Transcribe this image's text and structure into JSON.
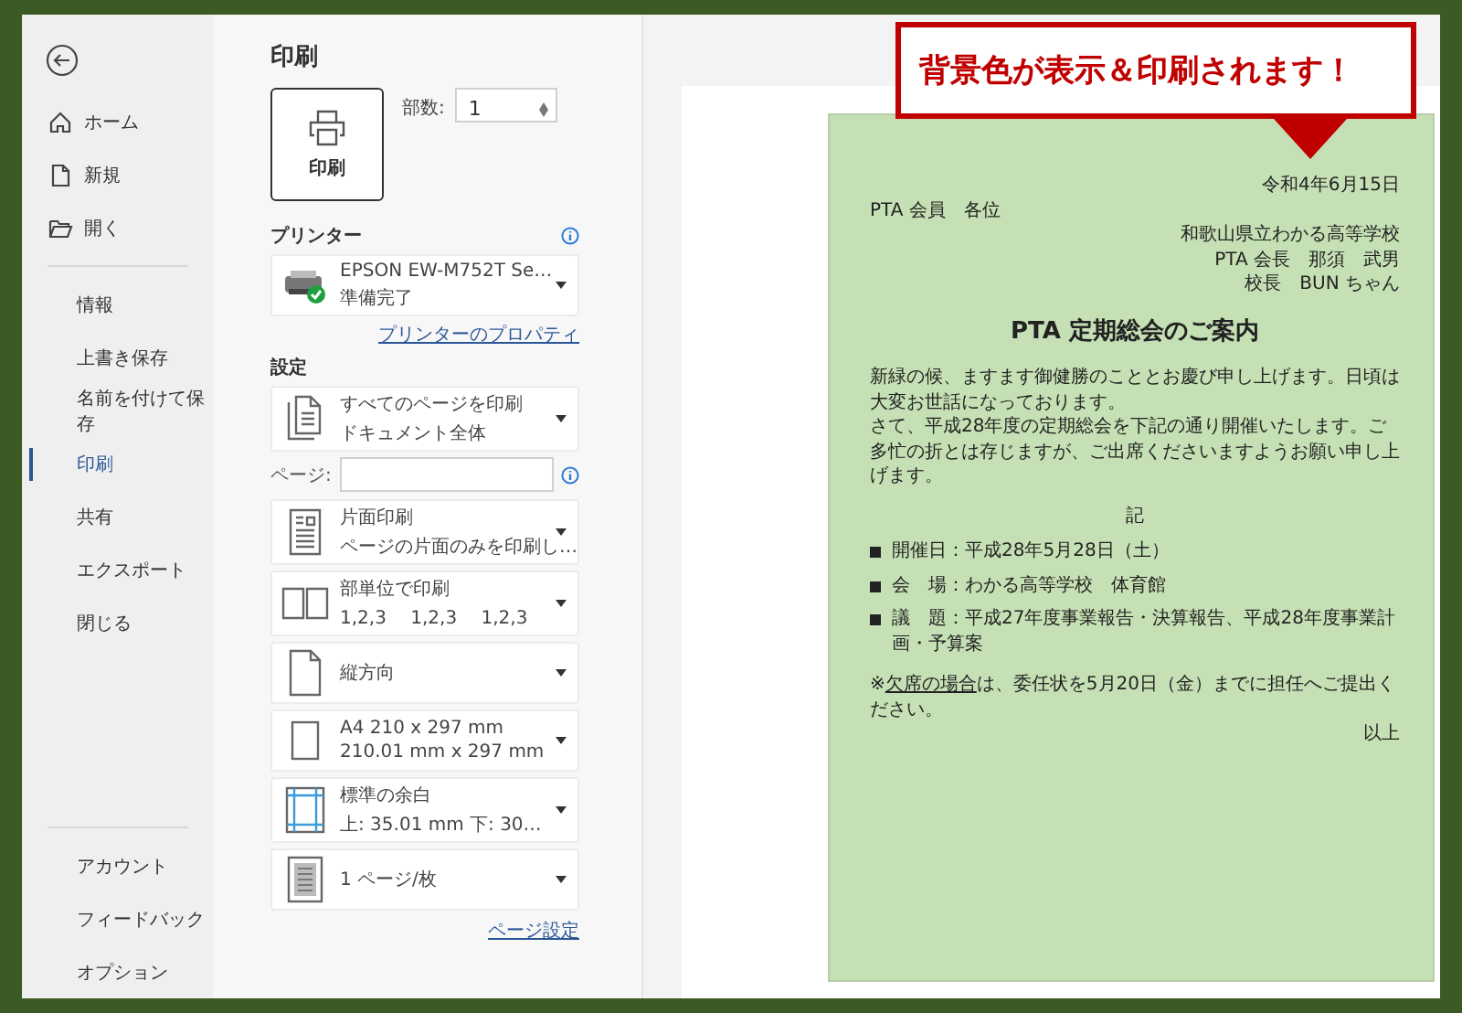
{
  "sidebar": {
    "top_items": [
      {
        "label": "ホーム",
        "kind": "home",
        "selected": false
      },
      {
        "label": "新規",
        "kind": "new",
        "selected": false
      },
      {
        "label": "開く",
        "kind": "open",
        "selected": false
      }
    ],
    "items": [
      {
        "label": "情報",
        "selected": false
      },
      {
        "label": "上書き保存",
        "selected": false
      },
      {
        "label": "名前を付けて保存",
        "selected": false
      },
      {
        "label": "印刷",
        "selected": true
      },
      {
        "label": "共有",
        "selected": false
      },
      {
        "label": "エクスポート",
        "selected": false
      },
      {
        "label": "閉じる",
        "selected": false
      }
    ],
    "bottom_items": [
      {
        "label": "アカウント",
        "selected": false
      },
      {
        "label": "フィードバック",
        "selected": false
      },
      {
        "label": "オプション",
        "selected": false
      }
    ]
  },
  "print_panel": {
    "title": "印刷",
    "print_button": "印刷",
    "copies_label": "部数:",
    "copies_value": "1",
    "printer_heading": "プリンター",
    "printer": {
      "name": "EPSON EW-M752T Se…",
      "status": "準備完了"
    },
    "printer_properties_link": "プリンターのプロパティ",
    "settings_heading": "設定",
    "settings": [
      {
        "kind": "pages",
        "line1": "すべてのページを印刷",
        "line2": "ドキュメント全体"
      },
      {
        "kind": "one-sided",
        "line1": "片面印刷",
        "line2": "ページの片面のみを印刷し…"
      },
      {
        "kind": "collated",
        "line1": "部単位で印刷",
        "line2": "1,2,3　 1,2,3　 1,2,3"
      },
      {
        "kind": "portrait",
        "line1": "縦方向"
      },
      {
        "kind": "paper",
        "line1": "A4 210 x 297 mm",
        "line2": "210.01 mm x 297 mm"
      },
      {
        "kind": "margins",
        "line1": "標準の余白",
        "line2": "上: 35.01 mm 下: 30…"
      },
      {
        "kind": "per-sheet",
        "line1": "1 ページ/枚"
      }
    ],
    "pages_label": "ページ:",
    "page_setup_link": "ページ設定"
  },
  "callout": {
    "text": "背景色が表示＆印刷されます！"
  },
  "document": {
    "date": "令和4年6月15日",
    "recipient": "PTA 会員　各位",
    "senders": [
      "和歌山県立わかる高等学校",
      "PTA 会長　那須　武男",
      "校長　BUN ちゃん"
    ],
    "title": "PTA 定期総会のご案内",
    "paragraphs": [
      "新緑の候、ますます御健勝のこととお慶び申し上げます。日頃は大変お世話になっております。",
      "さて、平成28年度の定期総会を下記の通り開催いたします。ご多忙の折とは存じますが、ご出席くださいますようお願い申し上げます。"
    ],
    "ki": "記",
    "items": [
      "開催日：平成28年5月28日（土）",
      "会　場：わかる高等学校　体育館",
      "議　題：平成27年度事業報告・決算報告、平成28年度事業計画・予算案"
    ],
    "note_prefix": "※",
    "note_underlined": "欠席の場合",
    "note_rest": "は、委任状を5月20日（金）までに担任へご提出ください。",
    "closing": "以上"
  }
}
